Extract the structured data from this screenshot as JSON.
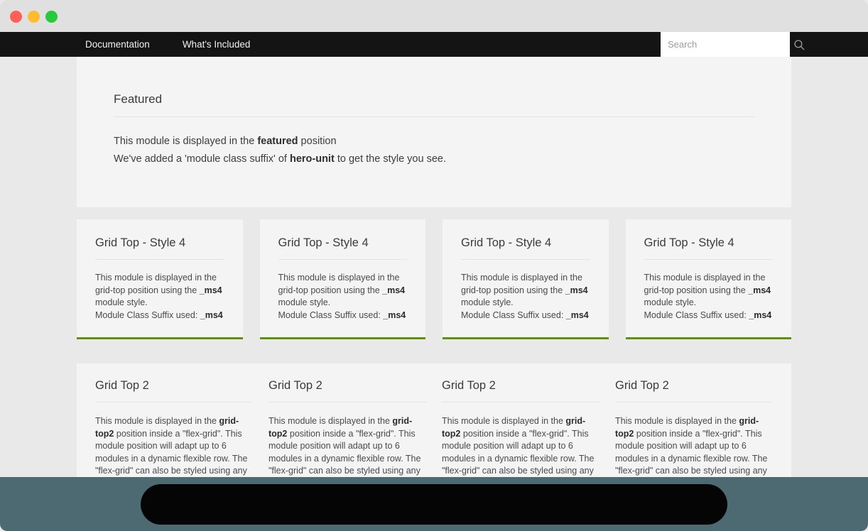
{
  "window": {
    "controls": [
      {
        "name": "close",
        "color": "#ff5f56"
      },
      {
        "name": "minimize",
        "color": "#ffbd2e"
      },
      {
        "name": "maximize",
        "color": "#27c93f"
      }
    ]
  },
  "navbar": {
    "background": "#141414",
    "links": [
      {
        "label": "Documentation"
      },
      {
        "label": "What's Included"
      }
    ],
    "search": {
      "placeholder": "Search",
      "value": "",
      "icon": "search-icon"
    }
  },
  "featured": {
    "title": "Featured",
    "line1_prefix": "This module is displayed in the ",
    "line1_bold": "featured",
    "line1_suffix": " position",
    "line2_prefix": "We've added a 'module class suffix' of ",
    "line2_bold": "hero-unit",
    "line2_suffix": " to get the style you see."
  },
  "grid_top_style4": {
    "accent_color": "#5e9110",
    "cards": [
      {
        "title": "Grid Top - Style 4",
        "text_prefix": "This module is displayed in the grid-top position using the ",
        "text_bold1": "_ms4",
        "text_mid": " module style.",
        "suffix_label": "Module Class Suffix used: ",
        "suffix_value": "_ms4"
      },
      {
        "title": "Grid Top - Style 4",
        "text_prefix": "This module is displayed in the grid-top position using the ",
        "text_bold1": "_ms4",
        "text_mid": " module style.",
        "suffix_label": "Module Class Suffix used: ",
        "suffix_value": "_ms4"
      },
      {
        "title": "Grid Top - Style 4",
        "text_prefix": "This module is displayed in the grid-top position using the ",
        "text_bold1": "_ms4",
        "text_mid": " module style.",
        "suffix_label": "Module Class Suffix used: ",
        "suffix_value": "_ms4"
      },
      {
        "title": "Grid Top - Style 4",
        "text_prefix": "This module is displayed in the grid-top position using the ",
        "text_bold1": "_ms4",
        "text_mid": " module style.",
        "suffix_label": "Module Class Suffix used: ",
        "suffix_value": "_ms4"
      }
    ]
  },
  "grid_top_2": {
    "columns": [
      {
        "title": "Grid Top 2",
        "text_prefix": "This module is displayed in the ",
        "text_bold": "grid-top2",
        "text_suffix": " position inside a \"flex-grid\". This module position will adapt up to 6 modules in a dynamic flexible row. The \"flex-grid\" can also be styled using any of the available"
      },
      {
        "title": "Grid Top 2",
        "text_prefix": "This module is displayed in the ",
        "text_bold": "grid-top2",
        "text_suffix": " position inside a \"flex-grid\". This module position will adapt up to 6 modules in a dynamic flexible row. The \"flex-grid\" can also be styled using any of the available"
      },
      {
        "title": "Grid Top 2",
        "text_prefix": "This module is displayed in the ",
        "text_bold": "grid-top2",
        "text_suffix": " position inside a \"flex-grid\". This module position will adapt up to 6 modules in a dynamic flexible row. The \"flex-grid\" can also be styled using any of the available"
      },
      {
        "title": "Grid Top 2",
        "text_prefix": "This module is displayed in the ",
        "text_bold": "grid-top2",
        "text_suffix": " position inside a \"flex-grid\". This module position will adapt up to 6 modules in a dynamic flexible row. The \"flex-grid\" can also be styled using any of the available"
      }
    ]
  },
  "footer": {
    "background": "#4d6a72",
    "pill_color": "#050505"
  }
}
